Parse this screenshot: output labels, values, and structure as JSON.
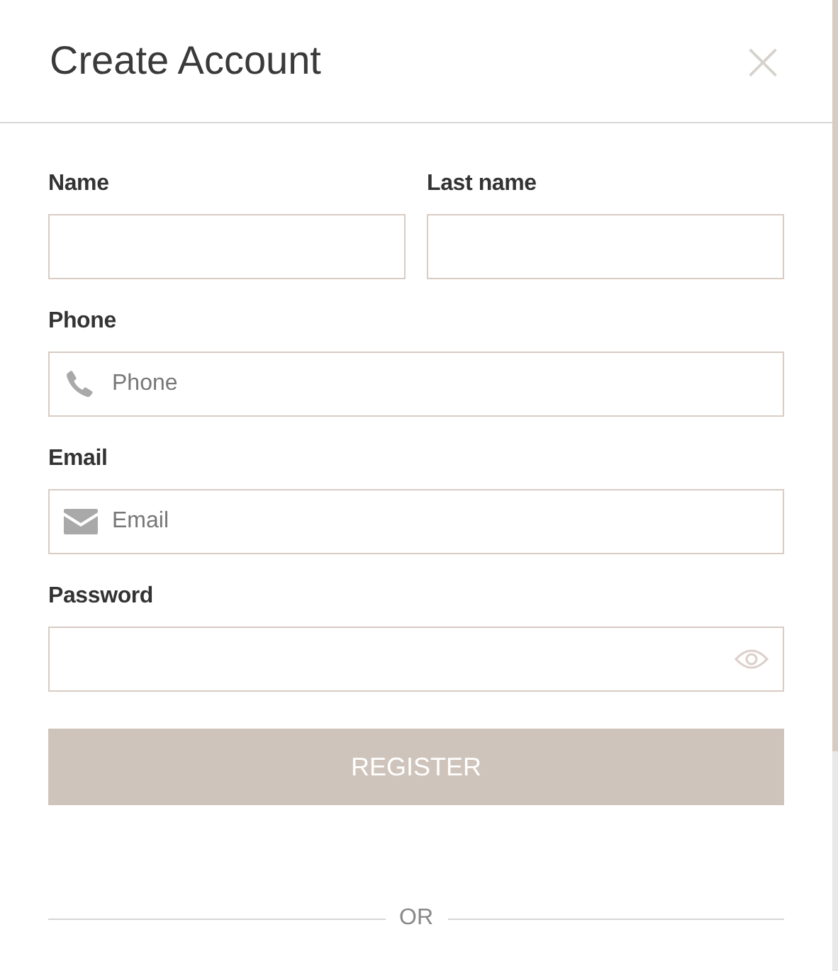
{
  "dialog": {
    "title": "Create Account",
    "close": "×"
  },
  "name_row": [
    {
      "label": "Name"
    },
    {
      "label": "Last name"
    }
  ],
  "fields": [
    {
      "kind": "phone",
      "label": "Phone",
      "placeholder": "Phone"
    },
    {
      "kind": "email",
      "label": "Email",
      "placeholder": "Email"
    },
    {
      "kind": "password",
      "label": "Password"
    }
  ],
  "submit": "REGISTER",
  "separator": "OR"
}
